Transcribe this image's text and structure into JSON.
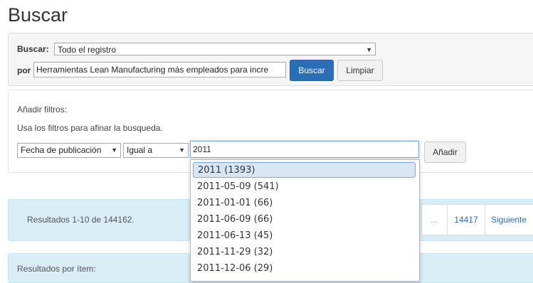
{
  "page": {
    "title": "Buscar"
  },
  "search": {
    "buscar_label": "Buscar:",
    "scope_value": "Todo el registro",
    "por_label": "por",
    "query_value": "Herramientas Lean Manufacturing más empleados para incre",
    "search_button": "Buscar",
    "clear_button": "Limpiar"
  },
  "filters": {
    "heading": "Añadir filtros:",
    "help": "Usa los filtros para afinar la busqueda.",
    "field_value": "Fecha de publicación",
    "operator_value": "Igual a",
    "filter_input_value": "2011",
    "add_button": "Añadir"
  },
  "autocomplete": {
    "items": [
      "2011 (1393)",
      "2011-05-09 (541)",
      "2011-01-01 (66)",
      "2011-06-09 (66)",
      "2011-06-13 (45)",
      "2011-11-29 (32)",
      "2011-12-06 (29)"
    ]
  },
  "results": {
    "summary": "Resultados 1-10 de 144162.",
    "pagination": {
      "ellipsis": "...",
      "last_page": "14417",
      "next": "Siguiente"
    },
    "per_item_label": "Resultados por ítem:"
  }
}
